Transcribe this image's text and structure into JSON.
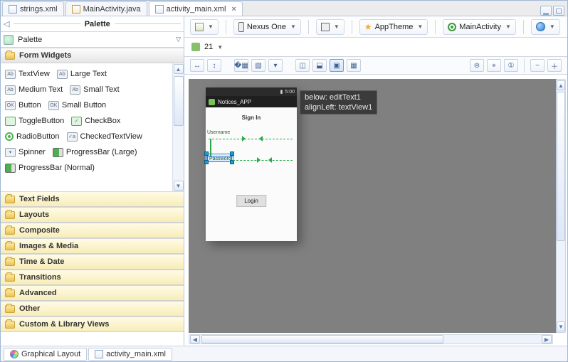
{
  "tabs": {
    "t0": "strings.xml",
    "t1": "MainActivity.java",
    "t2": "activity_main.xml"
  },
  "palette": {
    "title": "Palette",
    "section": "Palette",
    "formWidgets": "Form Widgets"
  },
  "widgets": {
    "textview": "TextView",
    "largetext": "Large Text",
    "mediumtext": "Medium Text",
    "smalltext": "Small Text",
    "button": "Button",
    "smallbutton": "Small Button",
    "toggle": "ToggleButton",
    "checkbox": "CheckBox",
    "radio": "RadioButton",
    "checkedtv": "CheckedTextView",
    "spinner": "Spinner",
    "pblarge": "ProgressBar (Large)",
    "pbnormal": "ProgressBar (Normal)"
  },
  "cats": {
    "textfields": "Text Fields",
    "layouts": "Layouts",
    "composite": "Composite",
    "images": "Images & Media",
    "time": "Time & Date",
    "transitions": "Transitions",
    "advanced": "Advanced",
    "other": "Other",
    "custom": "Custom & Library Views"
  },
  "config": {
    "device": "Nexus One",
    "theme": "AppTheme",
    "activity": "MainActivity",
    "api": "21"
  },
  "device": {
    "time": "5:00",
    "appname": "Notices_APP",
    "signin": "Sign In",
    "username": "Username",
    "password": "Password",
    "login": "Login"
  },
  "tooltip": {
    "l1": "below: editText1",
    "l2": "alignLeft: textView1"
  },
  "footer": {
    "graphical": "Graphical Layout",
    "file": "activity_main.xml"
  }
}
